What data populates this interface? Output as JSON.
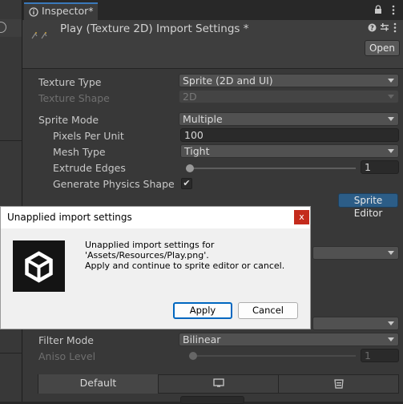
{
  "tab": {
    "label": "Inspector*"
  },
  "header": {
    "title": "Play (Texture 2D) Import Settings *",
    "open_label": "Open"
  },
  "fields": {
    "texture_type": {
      "label": "Texture Type",
      "value": "Sprite (2D and UI)"
    },
    "texture_shape": {
      "label": "Texture Shape",
      "value": "2D"
    },
    "sprite_mode": {
      "label": "Sprite Mode",
      "value": "Multiple"
    },
    "pixels_per_unit": {
      "label": "Pixels Per Unit",
      "value": "100"
    },
    "mesh_type": {
      "label": "Mesh Type",
      "value": "Tight"
    },
    "extrude_edges": {
      "label": "Extrude Edges",
      "value": "1",
      "fraction": 0.0
    },
    "generate_physics_shape": {
      "label": "Generate Physics Shape",
      "checked": true
    },
    "filter_mode": {
      "label": "Filter Mode",
      "value": "Bilinear"
    },
    "aniso_level": {
      "label": "Aniso Level",
      "value": "1",
      "fraction": 0.0
    }
  },
  "sprite_editor_label": "Sprite Editor",
  "platform_tabs": {
    "default_label": "Default",
    "pc_icon": "monitor-icon",
    "web_icon": "webgl-icon"
  },
  "dialog": {
    "title": "Unapplied import settings",
    "close_glyph": "x",
    "message_line1": "Unapplied import settings for",
    "message_line2": "'Assets/Resources/Play.png'.",
    "message_line3": "Apply and continue to sprite editor or cancel.",
    "apply_label": "Apply",
    "cancel_label": "Cancel",
    "icon": "unity-logo-icon"
  },
  "colors": {
    "accent": "#3a79bb",
    "sprite_editor_button": "#2c5d87",
    "dialog_close": "#c42b1c",
    "apply_focus": "#0067c0"
  }
}
